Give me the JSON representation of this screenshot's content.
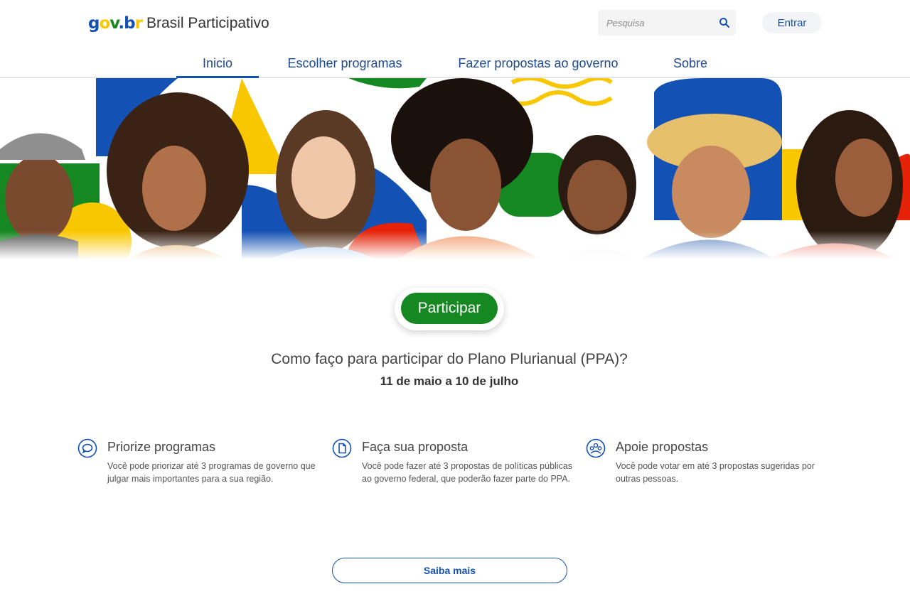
{
  "header": {
    "logo": {
      "g": "g",
      "o": "o",
      "v": "v",
      "dot": ".",
      "b": "b",
      "r": "r"
    },
    "site_title": "Brasil Participativo",
    "search_placeholder": "Pesquisa",
    "login_label": "Entrar"
  },
  "nav": {
    "tabs": [
      {
        "label": "Inicio"
      },
      {
        "label": "Escolher programas"
      },
      {
        "label": "Fazer propostas ao governo"
      },
      {
        "label": "Sobre"
      }
    ],
    "active_tab": "Inicio"
  },
  "main": {
    "cta_label": "Participar",
    "question": "Como faço para participar do Plano Plurianual (PPA)?",
    "dates": "11 de maio a 10 de julho",
    "features": [
      {
        "title": "Priorize programas",
        "description": "Você pode priorizar até 3 programas de governo que julgar mais importantes para a sua região.",
        "icon": "chat-bubble-icon"
      },
      {
        "title": "Faça sua proposta",
        "description": "Você pode fazer até 3 propostas de políticas públicas ao governo federal, que poderão fazer parte do PPA.",
        "icon": "document-icon"
      },
      {
        "title": "Apoie propostas",
        "description": "Você pode votar em até 3 propostas sugeridas por outras pessoas.",
        "icon": "people-group-icon"
      }
    ],
    "more_label": "Saiba mais"
  },
  "colors": {
    "primary_blue": "#1351b4",
    "green": "#168821",
    "yellow": "#f9c700",
    "red": "#e52207"
  }
}
